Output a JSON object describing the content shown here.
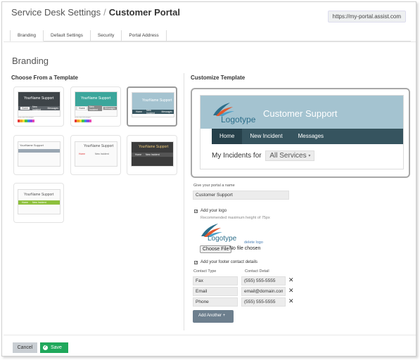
{
  "header": {
    "breadcrumb_root": "Service Desk Settings",
    "separator": "/",
    "page_title": "Customer Portal",
    "portal_url": "https://my-portal.assist.com"
  },
  "tabs": [
    {
      "label": "Branding"
    },
    {
      "label": "Default Settings"
    },
    {
      "label": "Security"
    },
    {
      "label": "Portal Address"
    }
  ],
  "section_title": "Branding",
  "left_heading": "Choose From a Template",
  "right_heading": "Customize Template",
  "templates": [
    {
      "title": "YourName Support",
      "nav": [
        "Home",
        "New Incident",
        "Messages"
      ],
      "swatch_label": "COLOR PICKER"
    },
    {
      "title": "YourName Support",
      "nav": [
        "Home",
        "New Incident",
        "Messages"
      ],
      "swatch_label": "COLOR PICKER"
    },
    {
      "title": "YourName Support",
      "nav": [
        "Home",
        "New Incident",
        "Messages"
      ]
    },
    {
      "title": "YourName Support"
    },
    {
      "title": "YourName Support",
      "nav": [
        "Home",
        "New Incident"
      ]
    },
    {
      "title": "YourName Support",
      "nav": [
        "Home",
        "New Incident"
      ]
    },
    {
      "title": "YourName Support",
      "nav": [
        "Home",
        "New Incident"
      ]
    }
  ],
  "preview": {
    "logo_text": "Logotype",
    "title": "Customer Support",
    "nav": [
      "Home",
      "New Incident",
      "Messages"
    ],
    "incidents_label": "My Incidents for",
    "incidents_filter": "All Services"
  },
  "form": {
    "portal_name_label": "Give your portal a name",
    "portal_name_value": "Customer Support",
    "logo_checkbox_label": "Add your logo",
    "logo_hint": "Recommended maximum height of 75px",
    "logo_text": "Logotype",
    "delete_logo": "delete logo",
    "choose_file": "Choose File",
    "no_file": "No file chosen",
    "footer_checkbox_label": "Add your footer contact details",
    "contact_type_header": "Contact Type",
    "contact_detail_header": "Contact Detail",
    "contacts": [
      {
        "type": "Fax",
        "detail": "(555) 555-5555"
      },
      {
        "type": "Email",
        "detail": "email@domain.com"
      },
      {
        "type": "Phone",
        "detail": "(555) 555-5555"
      }
    ],
    "add_another": "Add Another  +"
  },
  "footer": {
    "cancel": "Cancel",
    "save": "Save"
  },
  "colors": {
    "accent": "#1fa85b",
    "preview_header": "#a4c3d0",
    "preview_nav": "#36545f"
  }
}
